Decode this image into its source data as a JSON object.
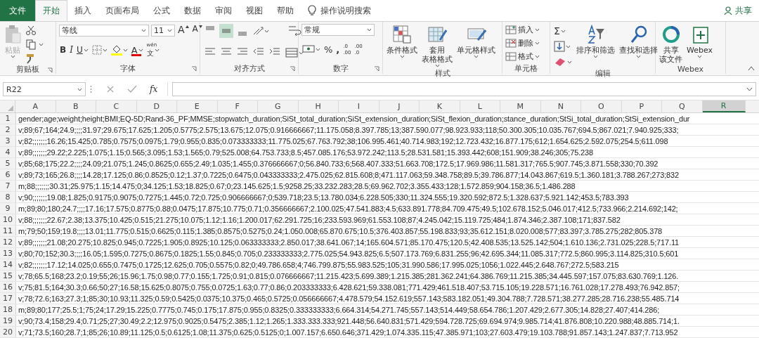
{
  "tabs": [
    {
      "label": "文件",
      "kind": "file",
      "selected": false
    },
    {
      "label": "开始",
      "kind": "tab",
      "selected": true
    },
    {
      "label": "插入",
      "kind": "tab",
      "selected": false
    },
    {
      "label": "页面布局",
      "kind": "tab",
      "selected": false
    },
    {
      "label": "公式",
      "kind": "tab",
      "selected": false
    },
    {
      "label": "数据",
      "kind": "tab",
      "selected": false
    },
    {
      "label": "审阅",
      "kind": "tab",
      "selected": false
    },
    {
      "label": "视图",
      "kind": "tab",
      "selected": false
    },
    {
      "label": "帮助",
      "kind": "tab",
      "selected": false
    }
  ],
  "tell_me": {
    "label": "操作说明搜索"
  },
  "share": {
    "label": "共享"
  },
  "ribbon": {
    "clipboard": {
      "paste": "粘贴",
      "paste_disabled": true,
      "label": "剪贴板"
    },
    "font": {
      "font_name": "等线",
      "font_size": "11",
      "grow": "A",
      "shrink": "A",
      "bold": "B",
      "italic": "I",
      "underline": "U",
      "font_color": "A",
      "phonetic": [
        "wén",
        "文"
      ],
      "label": "字体"
    },
    "alignment": {
      "vertical_align": [
        {
          "selected": false
        },
        {
          "selected": true
        },
        {
          "selected": false
        }
      ],
      "label": "对齐方式"
    },
    "number": {
      "format": "常规",
      "percent": "%",
      "comma": ",",
      "increase_decimal": [
        ".0",
        ".00"
      ],
      "decrease_decimal": [
        ".00",
        ".0"
      ],
      "label": "数字"
    },
    "styles": {
      "buttons": [
        [
          "条件格式"
        ],
        [
          "套用",
          "表格格式"
        ],
        [
          "单元格样式"
        ]
      ],
      "label": "样式"
    },
    "cells": {
      "buttons": [
        "插入",
        "删除",
        "格式"
      ],
      "label": "单元格"
    },
    "editing": {
      "sum": "Σ",
      "buttons": [
        "排序和筛选",
        "查找和选择"
      ],
      "label": "编辑"
    },
    "webex": {
      "buttons": [
        [
          "共享",
          "该文件"
        ],
        [
          "Webex"
        ]
      ],
      "label": "Webex"
    }
  },
  "formula_bar": {
    "name_box": "R22",
    "fx": "fx"
  },
  "columns": [
    {
      "label": "A",
      "selected": false
    },
    {
      "label": "B",
      "selected": false
    },
    {
      "label": "C",
      "selected": false
    },
    {
      "label": "D",
      "selected": false
    },
    {
      "label": "E",
      "selected": false
    },
    {
      "label": "F",
      "selected": false
    },
    {
      "label": "G",
      "selected": false
    },
    {
      "label": "H",
      "selected": false
    },
    {
      "label": "I",
      "selected": false
    },
    {
      "label": "J",
      "selected": false
    },
    {
      "label": "K",
      "selected": false
    },
    {
      "label": "L",
      "selected": false
    },
    {
      "label": "M",
      "selected": false
    },
    {
      "label": "N",
      "selected": false
    },
    {
      "label": "O",
      "selected": false
    },
    {
      "label": "P",
      "selected": false
    },
    {
      "label": "Q",
      "selected": false
    },
    {
      "label": "R",
      "selected": true
    }
  ],
  "rows": [
    {
      "number": "1",
      "text": "gender;age;weight;height;BMI;EQ-5D;Rand-36_PF;MMSE;stopwatch_duration;SiSt_total_duration;SiSt_extension_duration;SiSt_flexion_duration;stance_duration;StSi_total_duration;StSi_extension_dur"
    },
    {
      "number": "2",
      "text": "v;89;67;164;24.9;;;;31.97;29.675;17.625;1.205;0.5775;2.575;13.675;12.075;0.916666667;11.175.058;8.397.785;13;387.590.077;98.923.933;118;50.300.305;10.035.767;694.5;867.021;7.940.925;333;"
    },
    {
      "number": "3",
      "text": "v;82;;;;;;;16.26;15.425;0.785;0.7575;0.0975;1.79;0.955;0.835;0.073333333;11.775.025;67.763.792;38;106.995.461;40.714.983;192;12.723.432;16.877.175;612;1.654.625;2.592.075;254.5;611.098"
    },
    {
      "number": "4",
      "text": "v;89;;;;;;;29.22;2.225;1.075;1.15;0.565;3.095;1.53;1.565;0.79;525.008;64.753.733;8.5;457.085.176;53.972.242;113.5;28.531.581;15.393.442;608;151.909;38.246;305;75.238"
    },
    {
      "number": "5",
      "text": "v;85;68;175;22.2;;;;24.09;21.075;1.245;0.8625;0.655;2.49;1.035;1.455;0.376666667;0;56.840.733;6;568.407.333;51.663.708;172.5;17.969.986;11.581.317;765.5;907.745;3.871.558;330;70.392"
    },
    {
      "number": "6",
      "text": "v;89;73;165;26.8;;;;14.28;17.125;0.86;0.8525;0.12;1.37;0.7225;0.6475;0.043333333;2.475.025;62.815.608;8;471.117.063;59.348.758;89.5;39.786.877;14.043.867;619.5;1.360.181;3.788.267;273;832"
    },
    {
      "number": "7",
      "text": "m;88;;;;;;;30.31;25.975;1.15;14.475;0;34.125;1.53;18.825;0.67;0;23.145.625;1.5;9258.25;33.232.283;28.5;69.962.702;3.355.433;128;1.572.859;904.158;36.5;1.486.288"
    },
    {
      "number": "8",
      "text": "v;90;;;;;;;19.08;1.825;0.9175;0.9075;0.7275;1.445;0.72;0.725;0.906666667;0;539.718;23.5;13.780.034;6.228.505;330;11.324.555;19.320.592;872.5;1.328.637;5.921.142;453.5;783.393"
    },
    {
      "number": "9",
      "text": "m;89;80;180;24.7;;;;17.16;17.575;0.8775;0.88;0.0475;17.875;10.775;0.71;0.356666667;2.100.025;47.541.883;4.5;633.891.778;84.709.475;49.5;102.678.152;5.046.017;412.5;733.966;2.214.692;142;"
    },
    {
      "number": "10",
      "text": "v;88;;;;;;;22.67;2.38;13.375;10.425;0.515;21.275;10.075;1.12;1.16;1.200.017;62.291.725;16;233.593.969;61.553.108;87;4.245.042;15.119.725;484;1.874.346;2.387.108;171;837.582"
    },
    {
      "number": "11",
      "text": "m;79;50;159;19.8;;;;13.01;11.775;0.515;0.6625;0.115;1.385;0.8575;0.5275;0.24;1.050.008;65.870.675;10.5;376.403.857;55.198.833;93;35.612.151;8.020.008;577;83.397;3.785.275;282;805.378"
    },
    {
      "number": "12",
      "text": "v;89;;;;;;;21.08;20.275;10.825;0.945;0.7225;1.905;0.8925;10.125;0.063333333;2.850.017;38.641.067;14;165.604.571;85.170.475;120.5;42.408.535;13.525.142;504;1.610.136;2.731.025;228.5;717.11"
    },
    {
      "number": "13",
      "text": "v;80;70;152;30.3;;;;16.05;1.595;0.7275;0.8675;0.1825;1.55;0.845;0.705;0.233333333;2.775.025;54.943.825;6.5;507.173.769;6.831.255;96;42.695.344;11.085.317;772.5;860.995;3.114.825;310.5;601"
    },
    {
      "number": "14",
      "text": "v;82;;;;;;;17.12;14.025;0.655;0.7475;0.1725;12.625;0.705;0.5575;0.82;0;49.786.658;4;746.799.875;55.983.525;105;31.990.586;17.995.025;1056;1.022.445;2.648.767;272.5;583.215"
    },
    {
      "number": "15",
      "text": "v;78;65.5;168;23.2;0.19;55;26;15.96;1.75;0.98;0.77;0.155;1.725;0.91;0.815;0.076666667;11.215.423;5.699.389;1.215.385;281.362.241;64.386.769;11.215.385;34.445.597;157.075;83.630.769;1.126."
    },
    {
      "number": "16",
      "text": "v;75;81.5;164;30.3;0.66;50;27;16.58;15.625;0.8075;0.755;0.0725;1.63;0.77;0.86;0.203333333;6.428.621;59.338.081;771.429;461.518.407;53.715.105;19.228.571;16.761.028;17.278.493;76.942.857;"
    },
    {
      "number": "17",
      "text": "v;78;72.6;163;27.3;1;85;30;10.93;11.325;0.59;0.5425;0.0375;10.375;0.465;0.5725;0.056666667;4.478.579;54.152.619;557.143;583.182.051;49.304.788;7.728.571;38.277.285;28.716.238;55.485.714"
    },
    {
      "number": "18",
      "text": "m;89;80;177;25.5;1;75;24;17.29;15.225;0.7775;0.745;0.175;17.875;0.955;0.8325;0.333333333;6.664.314;54.271.745;557.143;514.449;58.654.786;1.207.429;2.677.305;14.828;27.407;414.286;"
    },
    {
      "number": "19",
      "text": "v;90;73.4;158;29.4;0.71;25;27;30.49;2.2;12.975;0.9025;0.5475;2.385;1.12;1.265;1.333.333.333;921.448;56.640.831;571.429;594.728.725;69.694.974;9.985.714;41.876.808;10.220.988;48.885.714;1."
    },
    {
      "number": "20",
      "text": "v;71;73.5;160;28.7;1;85;26;10.89;11.125;0.5;0.6125;1.08;11.375;0.625;0.5125;0;1.007.157;6.650.646;371.429;1.074.335.115;47.385.971;103;27.603.479;19.103.788;91.857.143;1.247.837;7.713.952"
    }
  ]
}
